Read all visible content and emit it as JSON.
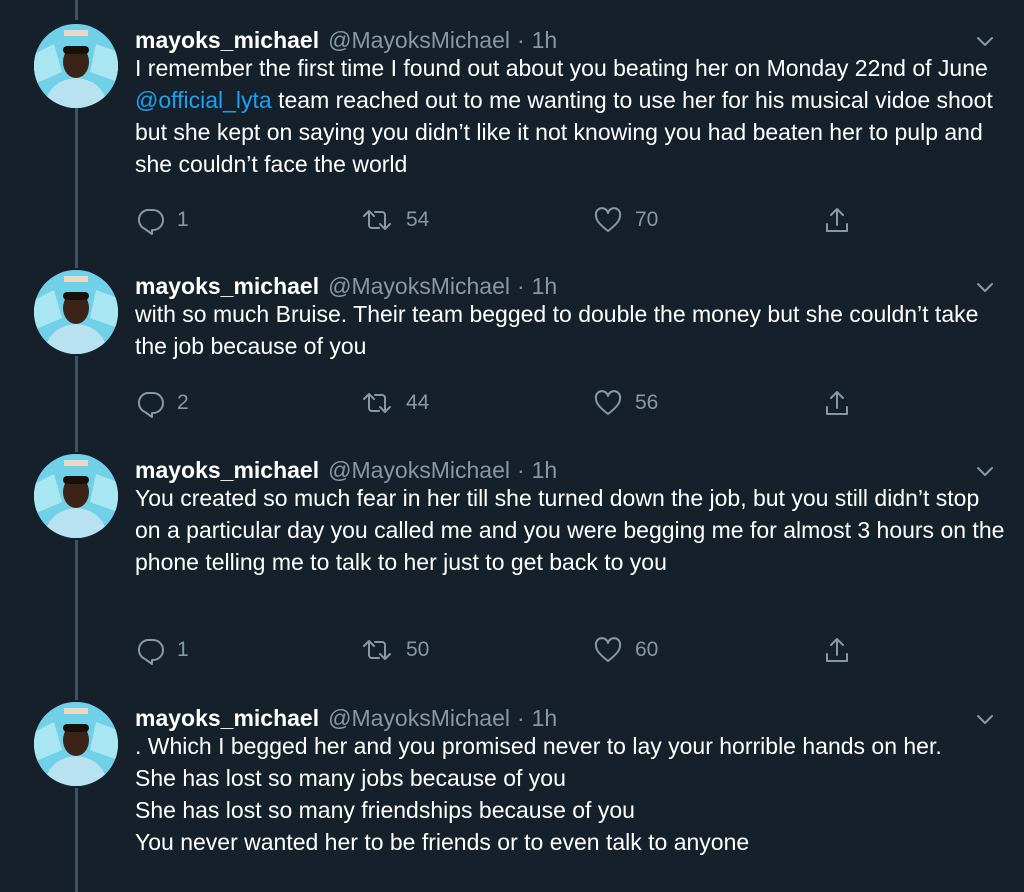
{
  "tweets": [
    {
      "display_name": "mayoks_michael",
      "handle": "@MayoksMichael",
      "separator": "·",
      "time": "1h",
      "text_before": "I remember the first time I found out about you beating her on Monday 22nd of June ",
      "mention": "@official_lyta",
      "text_after": " team reached out to me wanting to use her for his musical vidoe shoot but she kept on saying you didn’t like it not knowing you had beaten her to pulp and she couldn’t face the world",
      "replies": "1",
      "retweets": "54",
      "likes": "70"
    },
    {
      "display_name": "mayoks_michael",
      "handle": "@MayoksMichael",
      "separator": "·",
      "time": "1h",
      "text": "with so much Bruise. Their team begged to double the money but she couldn’t take the job because of you",
      "replies": "2",
      "retweets": "44",
      "likes": "56"
    },
    {
      "display_name": "mayoks_michael",
      "handle": "@MayoksMichael",
      "separator": "·",
      "time": "1h",
      "text": "You created so much fear in her till she turned down the job, but you still didn’t stop on a particular day you called me and you were begging me for almost 3 hours on the phone telling me to talk to her just to get back to you",
      "replies": "1",
      "retweets": "50",
      "likes": "60"
    },
    {
      "display_name": "mayoks_michael",
      "handle": "@MayoksMichael",
      "separator": "·",
      "time": "1h",
      "text": ". Which I begged her and you promised never to lay your horrible hands on her.\nShe has lost so many jobs because of you\nShe has lost so many friendships because of you\nYou never wanted her to be friends or to even talk to anyone"
    }
  ],
  "icons": {
    "reply": "reply-icon",
    "retweet": "retweet-icon",
    "like": "like-icon",
    "share": "share-icon",
    "more": "chevron-down-icon"
  },
  "colors": {
    "background": "#15202b",
    "text": "#ffffff",
    "muted": "#8899a6",
    "mention": "#1da1f2",
    "thread_line": "#3d5466"
  }
}
